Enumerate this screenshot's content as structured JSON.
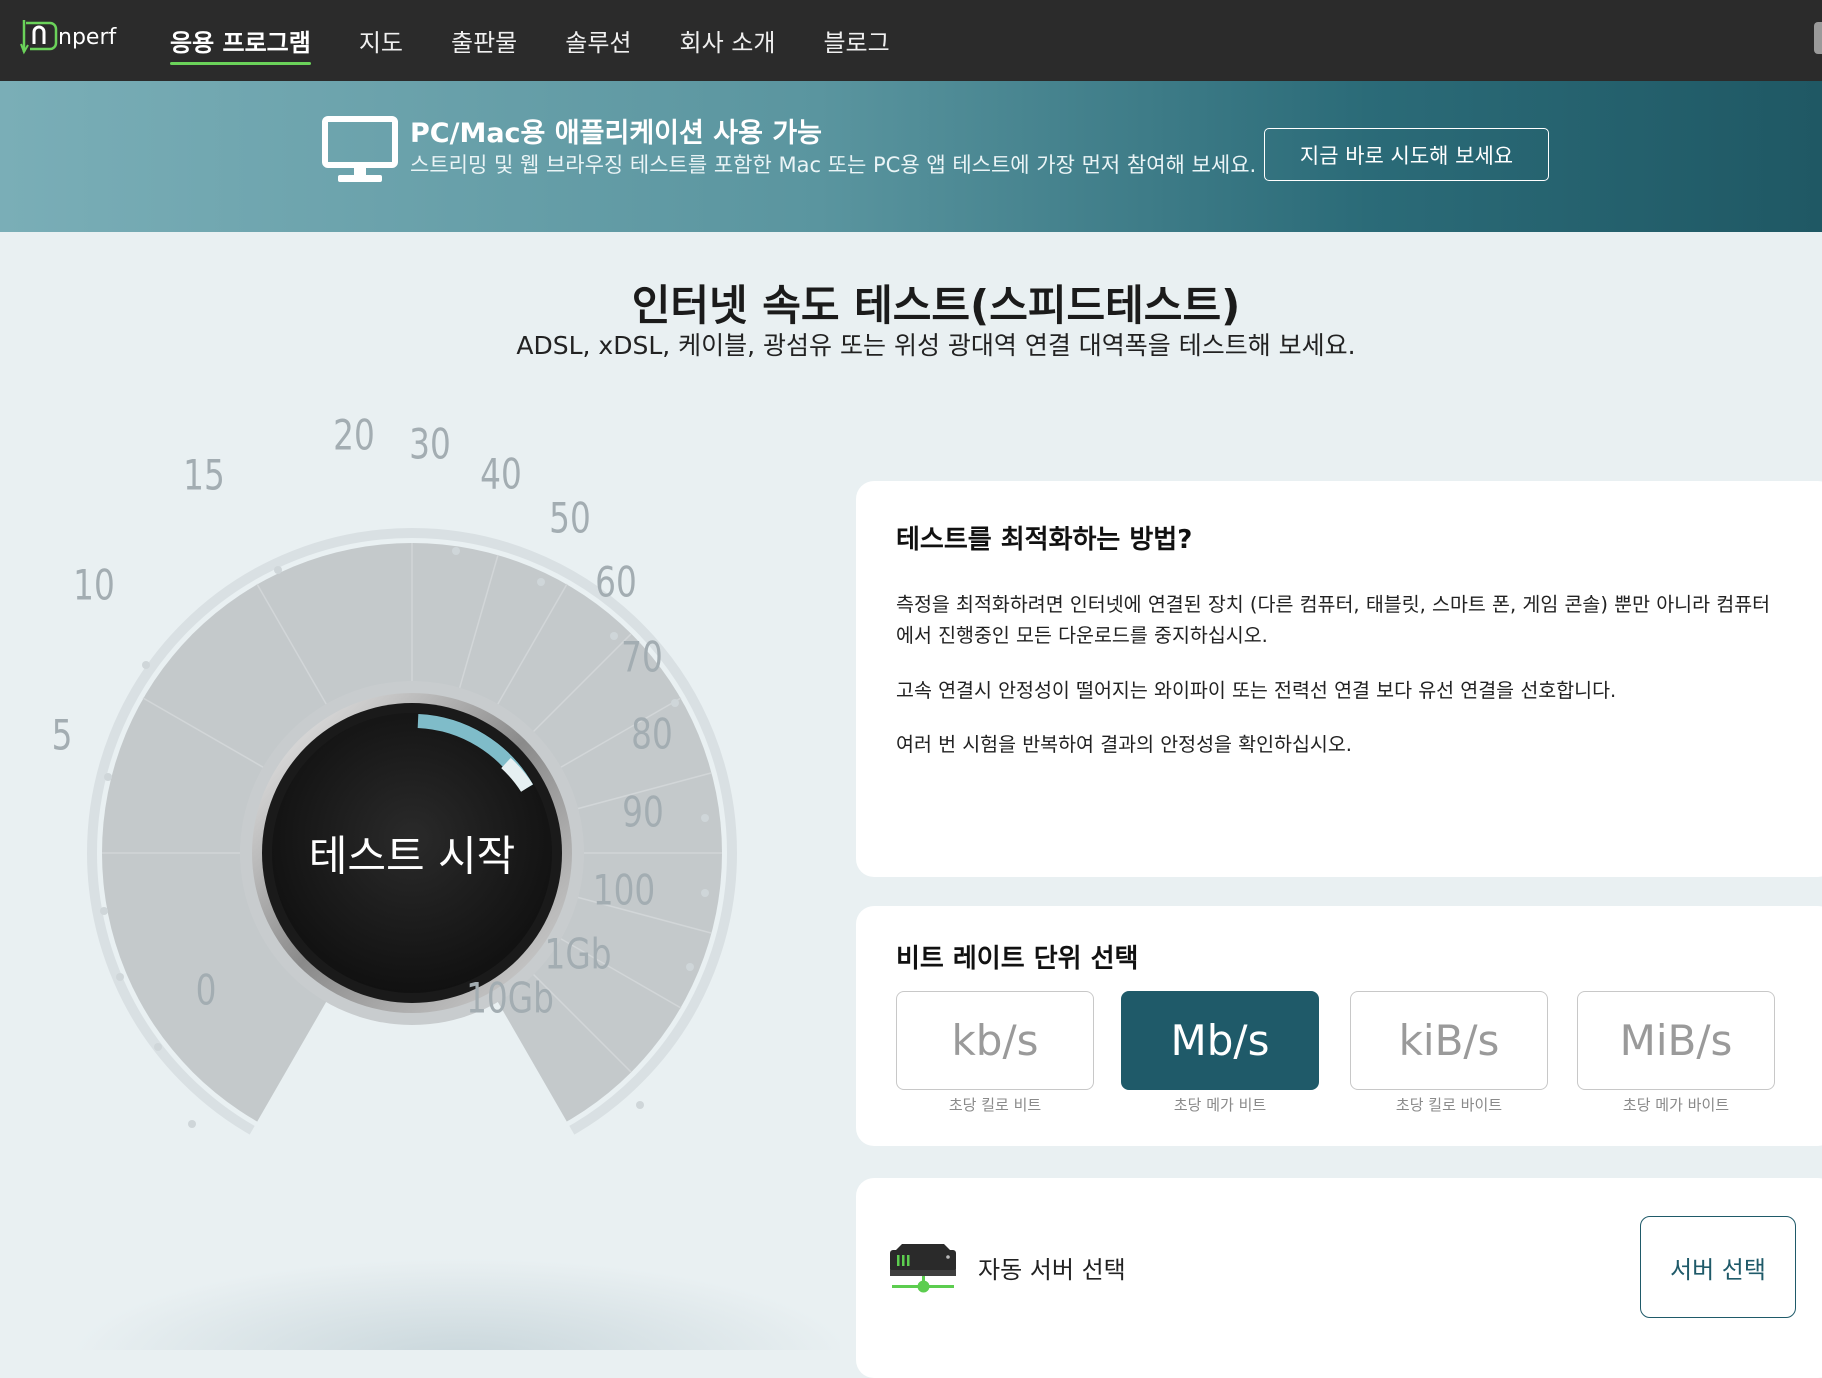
{
  "nav": {
    "logo_text": "nperf",
    "items": [
      {
        "label": "응용 프로그램",
        "active": true
      },
      {
        "label": "지도"
      },
      {
        "label": "출판물"
      },
      {
        "label": "솔루션"
      },
      {
        "label": "회사 소개"
      },
      {
        "label": "블로그"
      }
    ],
    "accent_color": "#6bd35a"
  },
  "banner": {
    "title": "PC/Mac용 애플리케이션 사용 가능",
    "subtitle": "스트리밍 및 웹 브라우징 테스트를 포함한 Mac 또는 PC용 앱 테스트에 가장 먼저 참여해 보세요.",
    "button": "지금 바로 시도해 보세요",
    "icon": "monitor-icon"
  },
  "page": {
    "title": "인터넷 속도 테스트(스피드테스트)",
    "subtitle": "ADSL, xDSL, 케이블, 광섬유 또는 위성 광대역 연결 대역폭을 테스트해 보세요."
  },
  "gauge": {
    "start_label": "테스트 시작",
    "ticks": [
      "0",
      "5",
      "10",
      "15",
      "20",
      "30",
      "40",
      "50",
      "60",
      "70",
      "80",
      "90",
      "100",
      "1Gb",
      "10Gb"
    ],
    "accent_color": "#6fb3c1"
  },
  "tips": {
    "title": "테스트를 최적화하는 방법?",
    "items": [
      "측정을 최적화하려면 인터넷에 연결된 장치 (다른 컴퓨터, 태블릿, 스마트 폰, 게임 콘솔) 뿐만 아니라 컴퓨터에서 진행중인 모든 다운로드를 중지하십시오.",
      "고속 연결시 안정성이 떨어지는 와이파이 또는 전력선 연결 보다 유선 연결을 선호합니다.",
      "여러 번 시험을 반복하여 결과의 안정성을 확인하십시오."
    ]
  },
  "units": {
    "title": "비트 레이트 단위 선택",
    "options": [
      {
        "label": "kb/s",
        "caption": "초당 킬로 비트",
        "selected": false
      },
      {
        "label": "Mb/s",
        "caption": "초당 메가 비트",
        "selected": true
      },
      {
        "label": "kiB/s",
        "caption": "초당 킬로 바이트",
        "selected": false
      },
      {
        "label": "MiB/s",
        "caption": "초당 메가 바이트",
        "selected": false
      }
    ],
    "selected_color": "#1f5a69"
  },
  "server": {
    "label": "자동 서버 선택",
    "button": "서버 선택",
    "icon": "server-icon"
  }
}
